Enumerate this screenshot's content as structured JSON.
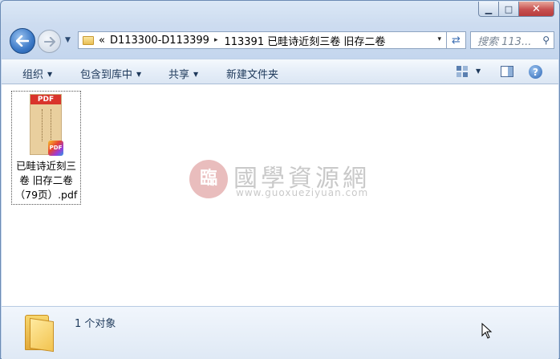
{
  "window": {
    "minimize_glyph": "▁",
    "maximize_glyph": "□",
    "close_glyph": "✕"
  },
  "address": {
    "prefix": "«",
    "crumbs": [
      {
        "label": "D113300-D113399"
      },
      {
        "label": "113391 已畦诗近刻三卷 旧存二卷"
      }
    ],
    "separator": "▸",
    "dropdown": "▾"
  },
  "search": {
    "placeholder": "搜索 113..."
  },
  "toolbar": {
    "organize": "组织",
    "include_in_library": "包含到库中",
    "share": "共享",
    "new_folder": "新建文件夹"
  },
  "files": [
    {
      "name": "已畦诗近刻三卷 旧存二卷（79页）.pdf",
      "thumb_header": "PDF",
      "badge": "PDF",
      "icon": "pdf-file-icon"
    }
  ],
  "watermark": {
    "logo_char": "臨",
    "title": "國學資源網",
    "url": "www.guoxueziyuan.com"
  },
  "details": {
    "count_text": "1 个对象"
  },
  "colors": {
    "accent": "#3a78c6",
    "close_red": "#c75050",
    "pdf_red": "#d9342b"
  }
}
